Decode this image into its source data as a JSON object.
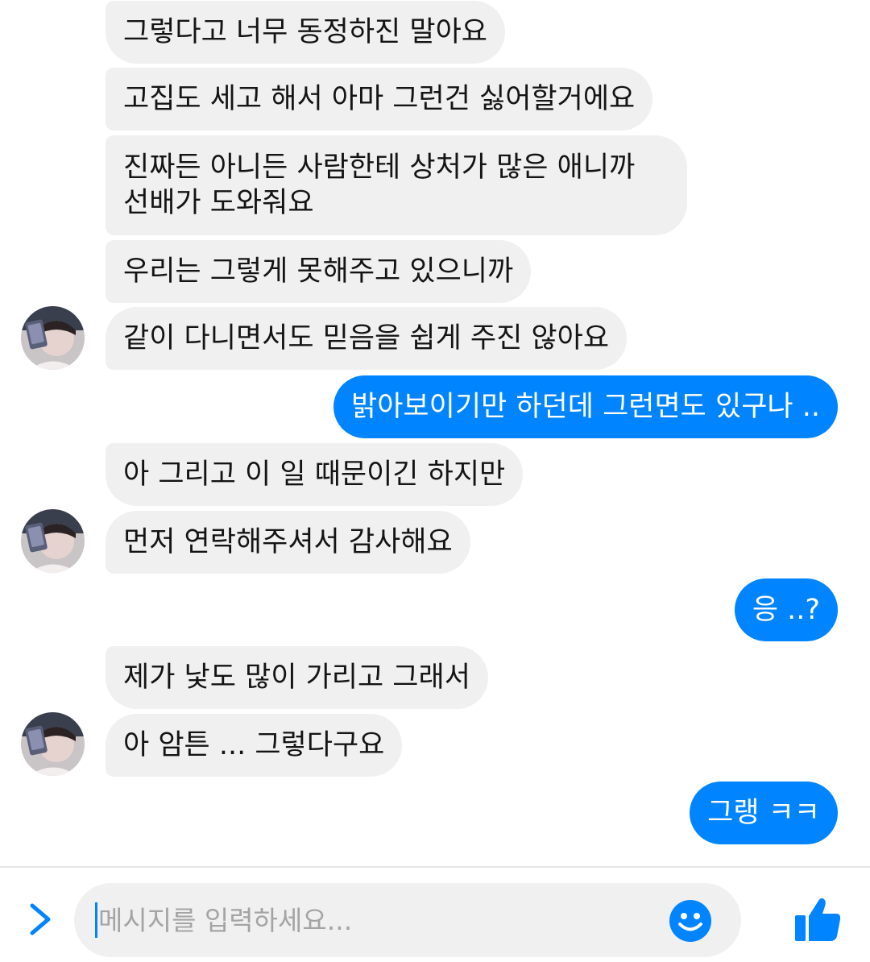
{
  "messages": [
    {
      "text": "그렇다고 너무 동정하진 말아요"
    },
    {
      "text": "고집도 세고 해서 아마 그런건 싫어할거에요"
    },
    {
      "text": "진짜든 아니든 사람한테 상처가 많은 애니까 선배가 도와줘요"
    },
    {
      "text": "우리는 그렇게 못해주고 있으니까"
    },
    {
      "text": "같이 다니면서도 믿음을 쉽게 주진 않아요"
    },
    {
      "text": "밝아보이기만 하던데 그런면도 있구나 .."
    },
    {
      "text": "아 그리고 이 일 때문이긴 하지만"
    },
    {
      "text": "먼저 연락해주셔서 감사해요"
    },
    {
      "text": "응 ..?"
    },
    {
      "text": "제가 낯도 많이 가리고 그래서"
    },
    {
      "text": "아 암튼 ... 그렇다구요"
    },
    {
      "text": "그랭 ㅋㅋ"
    }
  ],
  "composer": {
    "placeholder": "메시지를 입력하세요..."
  },
  "icons": {
    "expand": "chevron-right-icon",
    "emoji": "smiley-icon",
    "like": "thumbs-up-icon"
  },
  "colors": {
    "accent": "#0084ff",
    "incoming_bubble": "#f0f0f0"
  }
}
